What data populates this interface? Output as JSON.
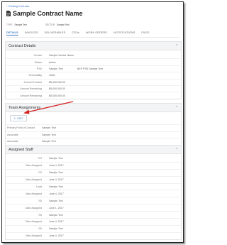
{
  "breadcrumb": {
    "label": "Existing Contracts"
  },
  "header": {
    "title": "Sample Contract Name"
  },
  "meta": {
    "type_label": "TYPE",
    "type_value": "Sample Text",
    "sector_label": "SECTOR",
    "sector_value": "Sample Text"
  },
  "tabs": [
    "DETAILS",
    "INVOICES",
    "DELIVERABLES",
    "CSOs",
    "WORK ORDERS",
    "NOTIFICATIONS",
    "FILES"
  ],
  "contract_details": {
    "heading": "Contract Details",
    "rows": [
      {
        "label": "Vendor",
        "value": "Sample Vendor Name"
      },
      {
        "label": "Status",
        "value": "Active"
      },
      {
        "label": "PSS",
        "value": "Sample Text",
        "value2": "NEP PSS Sample Text"
      },
      {
        "label": "Severability",
        "value": "Other"
      },
      {
        "label": "Amount Funded",
        "value": "$5,000,000.00"
      },
      {
        "label": "Amount Remaining",
        "value": "$5,000,000.00"
      },
      {
        "label": "Amount Remaining",
        "value": "$5,000,000.00"
      }
    ]
  },
  "team_assignments": {
    "heading": "Team Assignments",
    "edit_label": "EDIT",
    "rows": [
      {
        "label": "Primary Point of Contact",
        "value": "Sample Text"
      },
      {
        "label": "Associate",
        "value": "Sample Text"
      },
      {
        "label": "Associate",
        "value": "Sample Text"
      }
    ]
  },
  "assigned_staff": {
    "heading": "Assigned Staff",
    "rows": [
      {
        "label": "CO",
        "value": "Sample Text"
      },
      {
        "label": "Date Assigned",
        "value": "June 4, 2017"
      },
      {
        "label": "CS",
        "value": "Sample Text"
      },
      {
        "label": "Date Assigned",
        "value": "June 4, 2017"
      },
      {
        "label": "Lead",
        "value": "Sample Text"
      },
      {
        "label": "Date Assigned",
        "value": "June 4, 2017"
      },
      {
        "label": "SS",
        "value": "Sample Text"
      },
      {
        "label": "Date Assigned",
        "value": "June 1, 2017"
      },
      {
        "label": "SS",
        "value": "Sample Text"
      },
      {
        "label": "Date Assigned",
        "value": "June 4, 2017"
      },
      {
        "label": "SS",
        "value": "Sample Text"
      },
      {
        "label": "Date Assigned",
        "value": "June 4, 2017"
      }
    ]
  },
  "colors": {
    "accent": "#3a78c4",
    "annotation_arrow": "#d42020"
  }
}
